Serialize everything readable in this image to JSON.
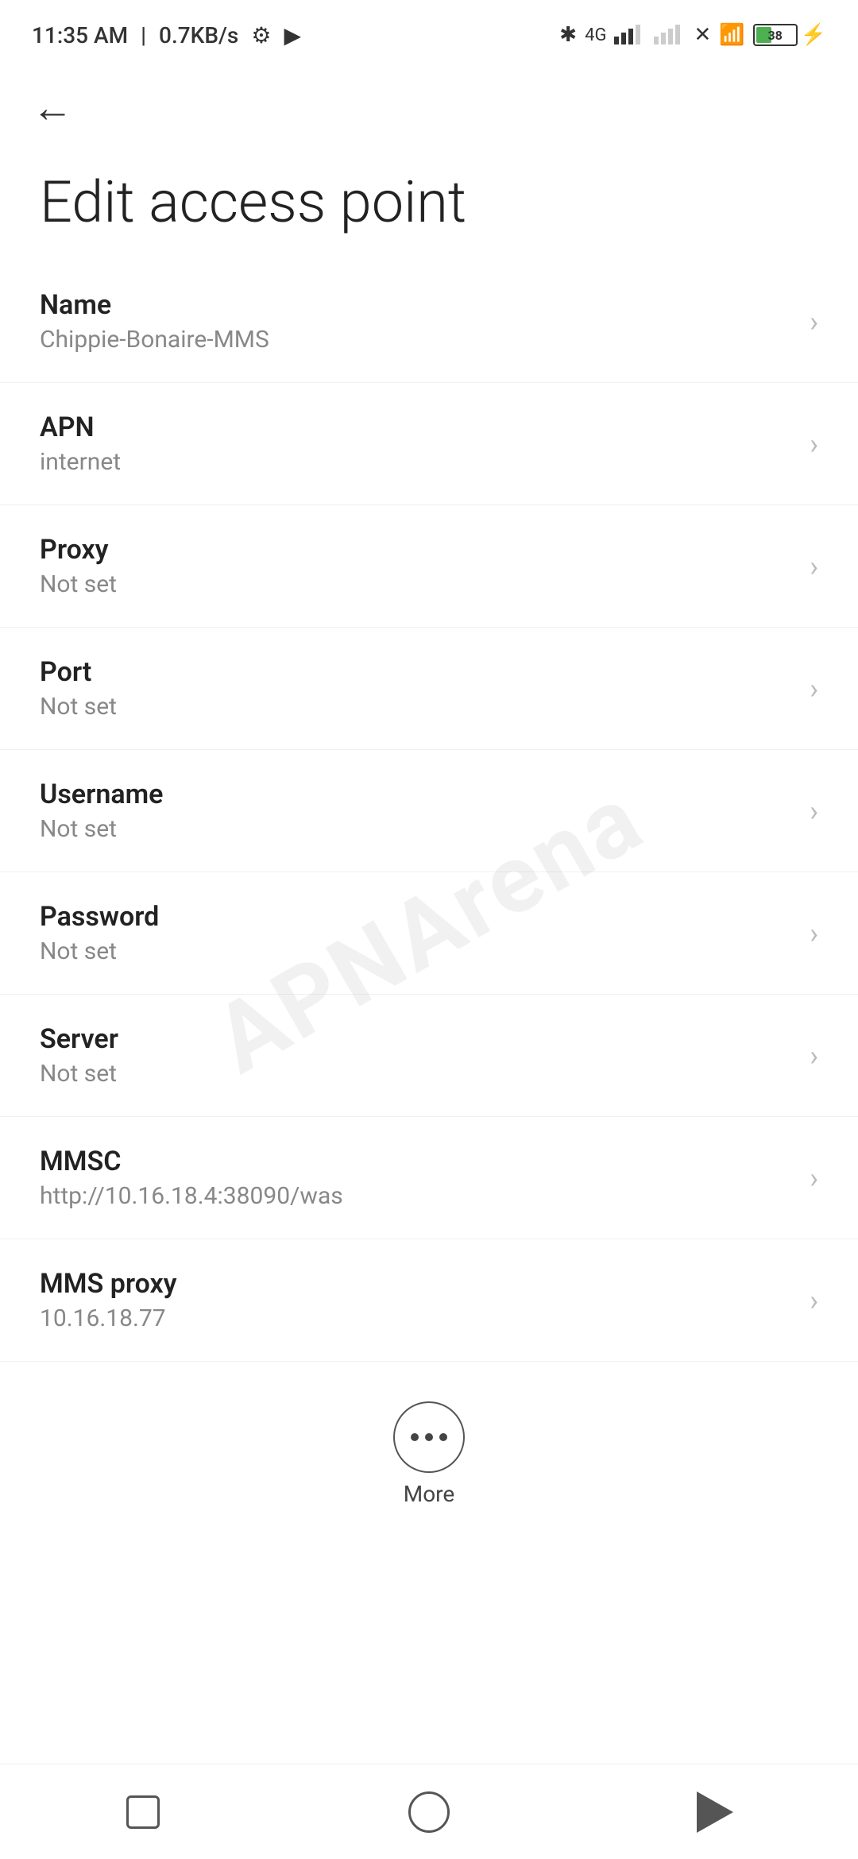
{
  "statusBar": {
    "time": "11:35 AM",
    "speed": "0.7KB/s",
    "battery": "38"
  },
  "nav": {
    "backLabel": "←"
  },
  "page": {
    "title": "Edit access point"
  },
  "settings": [
    {
      "label": "Name",
      "value": "Chippie-Bonaire-MMS"
    },
    {
      "label": "APN",
      "value": "internet"
    },
    {
      "label": "Proxy",
      "value": "Not set"
    },
    {
      "label": "Port",
      "value": "Not set"
    },
    {
      "label": "Username",
      "value": "Not set"
    },
    {
      "label": "Password",
      "value": "Not set"
    },
    {
      "label": "Server",
      "value": "Not set"
    },
    {
      "label": "MMSC",
      "value": "http://10.16.18.4:38090/was"
    },
    {
      "label": "MMS proxy",
      "value": "10.16.18.77"
    }
  ],
  "more": {
    "label": "More"
  },
  "watermark": {
    "text": "APNArena"
  }
}
